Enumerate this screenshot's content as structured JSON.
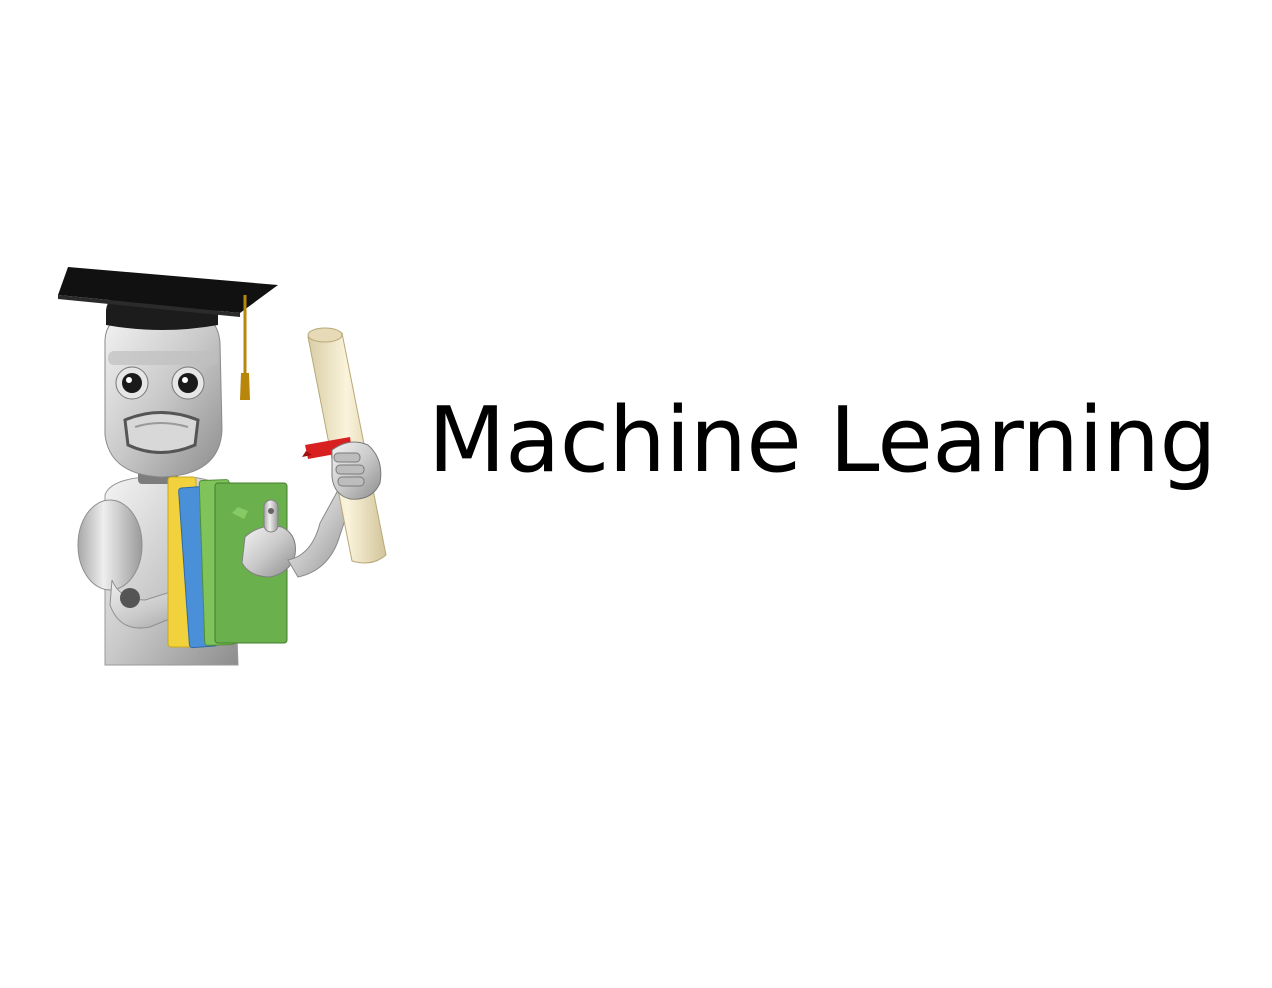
{
  "slide": {
    "title": "Machine Learning"
  },
  "mascot": {
    "description_icon": "graduate-robot-illustration",
    "items": [
      "graduation-cap-icon",
      "diploma-scroll-icon",
      "books-icon"
    ]
  },
  "colors": {
    "background": "#ffffff",
    "text": "#000000",
    "cap": "#1c1c1c",
    "tassel": "#b8860b",
    "robot_body": "#cfcfcf",
    "book_yellow": "#f2d23c",
    "book_blue": "#4a90d9",
    "book_green": "#6ab04c",
    "scroll": "#efe6c8",
    "ribbon": "#d82020"
  }
}
